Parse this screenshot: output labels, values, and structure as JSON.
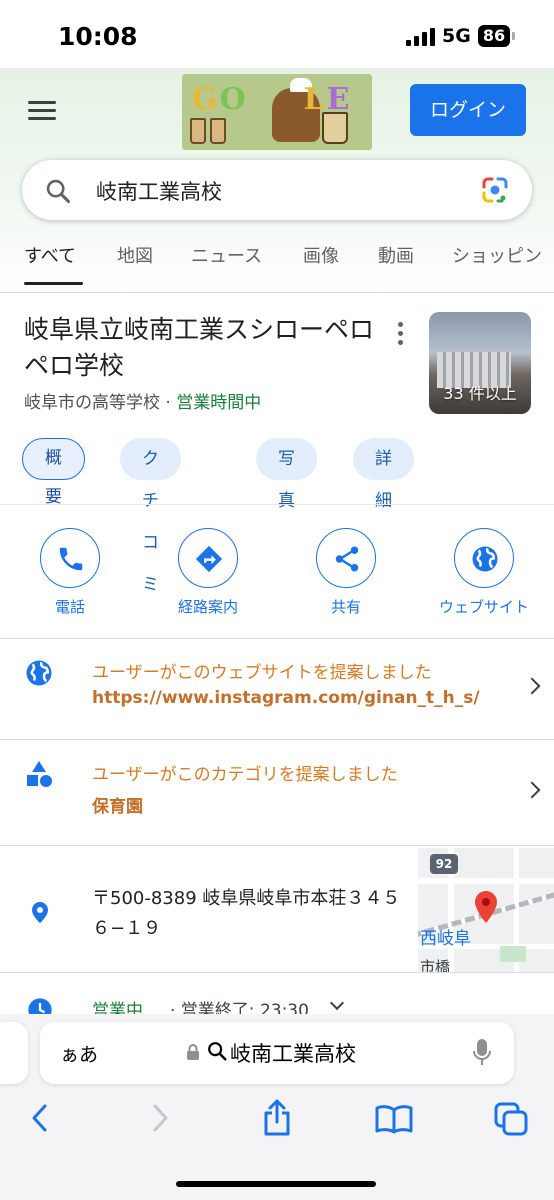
{
  "status_bar": {
    "time": "10:08",
    "network": "5G",
    "battery": "86"
  },
  "header": {
    "doodle_word": "GOOGLE",
    "login_label": "ログイン",
    "search_query": "岐南工業高校",
    "tabs": [
      "すべて",
      "地図",
      "ニュース",
      "画像",
      "動画",
      "ショッピン"
    ],
    "active_tab": "すべて"
  },
  "knowledge_panel": {
    "title": "岐阜県立岐南工業スシローペロペロ学校",
    "category": "岐阜市の高等学校",
    "separator": "·",
    "open_status": "営業時間中",
    "photo_count": "33 件以上",
    "chips": [
      "概要",
      "クチコミ",
      "写真",
      "詳細"
    ]
  },
  "actions": [
    {
      "label": "電話",
      "icon": "phone-icon"
    },
    {
      "label": "経路案内",
      "icon": "directions-icon"
    },
    {
      "label": "共有",
      "icon": "share-icon"
    },
    {
      "label": "ウェブサイト",
      "icon": "globe-icon"
    }
  ],
  "suggestions": {
    "website": {
      "label": "ユーザーがこのウェブサイトを提案しました",
      "value": "https://www.instagram.com/ginan_t_h_s/"
    },
    "category": {
      "label": "ユーザーがこのカテゴリを提案しました",
      "value": "保育園"
    }
  },
  "address": {
    "text": "〒500-8389 岐阜県岐阜市本荘３４５６−１９",
    "map_route": "92",
    "map_station": "西岐阜",
    "map_place": "市橋"
  },
  "hours": {
    "open": "営業中",
    "close": "· 営業終了: 23:30"
  },
  "safari": {
    "aa_label": "ぁあ",
    "url_text": "岐南工業高校"
  },
  "colors": {
    "accent": "#1a73e8",
    "open_green": "#188038",
    "suggestion_orange": "#d97a1e"
  }
}
